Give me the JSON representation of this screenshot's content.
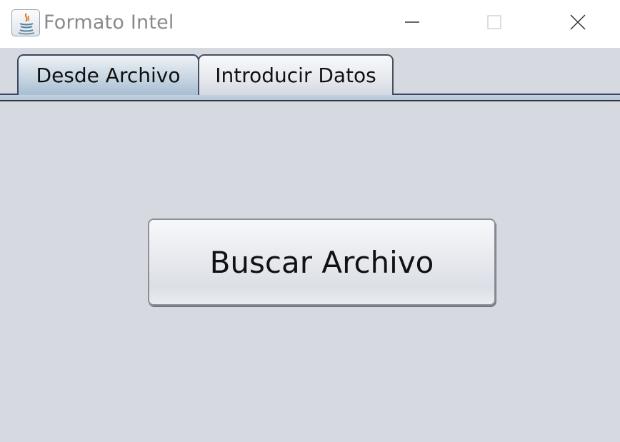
{
  "window": {
    "title": "Formato Intel",
    "icon": "java-icon",
    "controls": [
      "minimize-icon",
      "maximize-icon",
      "close-icon"
    ]
  },
  "tabs": [
    {
      "label": "Desde Archivo",
      "selected": true
    },
    {
      "label": "Introducir Datos",
      "selected": false
    }
  ],
  "main": {
    "search_button_label": "Buscar Archivo"
  },
  "colors": {
    "background": "#d6d9e0",
    "titlebar": "#ffffff",
    "tab_selected": "#b9cbdc",
    "border": "#3b4760"
  }
}
